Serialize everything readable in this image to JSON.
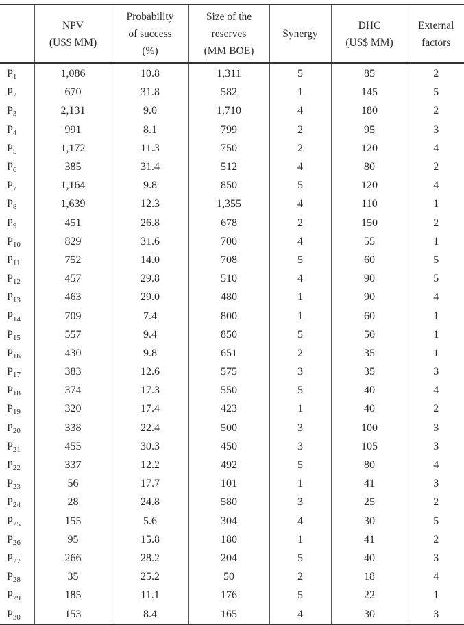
{
  "table": {
    "headers": [
      "",
      "NPV (US$ MM)",
      "Probability of success (%)",
      "Size of the reserves (MM BOE)",
      "Synergy",
      "DHC (US$ MM)",
      "External factors"
    ],
    "header_lines": [
      [
        ""
      ],
      [
        "NPV",
        "(US$ MM)"
      ],
      [
        "Probability",
        "of success",
        "(%)"
      ],
      [
        "Size of the",
        "reserves",
        "(MM BOE)"
      ],
      [
        "Synergy"
      ],
      [
        "DHC",
        "(US$ MM)"
      ],
      [
        "External",
        "factors"
      ]
    ],
    "rows": [
      {
        "id": "P",
        "sub": "1",
        "npv": "1,086",
        "pos": "10.8",
        "reserves": "1,311",
        "synergy": "5",
        "dhc": "85",
        "external": "2"
      },
      {
        "id": "P",
        "sub": "2",
        "npv": "670",
        "pos": "31.8",
        "reserves": "582",
        "synergy": "1",
        "dhc": "145",
        "external": "5"
      },
      {
        "id": "P",
        "sub": "3",
        "npv": "2,131",
        "pos": "9.0",
        "reserves": "1,710",
        "synergy": "4",
        "dhc": "180",
        "external": "2"
      },
      {
        "id": "P",
        "sub": "4",
        "npv": "991",
        "pos": "8.1",
        "reserves": "799",
        "synergy": "2",
        "dhc": "95",
        "external": "3"
      },
      {
        "id": "P",
        "sub": "5",
        "npv": "1,172",
        "pos": "11.3",
        "reserves": "750",
        "synergy": "2",
        "dhc": "120",
        "external": "4"
      },
      {
        "id": "P",
        "sub": "6",
        "npv": "385",
        "pos": "31.4",
        "reserves": "512",
        "synergy": "4",
        "dhc": "80",
        "external": "2"
      },
      {
        "id": "P",
        "sub": "7",
        "npv": "1,164",
        "pos": "9.8",
        "reserves": "850",
        "synergy": "5",
        "dhc": "120",
        "external": "4"
      },
      {
        "id": "P",
        "sub": "8",
        "npv": "1,639",
        "pos": "12.3",
        "reserves": "1,355",
        "synergy": "4",
        "dhc": "110",
        "external": "1"
      },
      {
        "id": "P",
        "sub": "9",
        "npv": "451",
        "pos": "26.8",
        "reserves": "678",
        "synergy": "2",
        "dhc": "150",
        "external": "2"
      },
      {
        "id": "P",
        "sub": "10",
        "npv": "829",
        "pos": "31.6",
        "reserves": "700",
        "synergy": "4",
        "dhc": "55",
        "external": "1"
      },
      {
        "id": "P",
        "sub": "11",
        "npv": "752",
        "pos": "14.0",
        "reserves": "708",
        "synergy": "5",
        "dhc": "60",
        "external": "5"
      },
      {
        "id": "P",
        "sub": "12",
        "npv": "457",
        "pos": "29.8",
        "reserves": "510",
        "synergy": "4",
        "dhc": "90",
        "external": "5"
      },
      {
        "id": "P",
        "sub": "13",
        "npv": "463",
        "pos": "29.0",
        "reserves": "480",
        "synergy": "1",
        "dhc": "90",
        "external": "4"
      },
      {
        "id": "P",
        "sub": "14",
        "npv": "709",
        "pos": "7.4",
        "reserves": "800",
        "synergy": "1",
        "dhc": "60",
        "external": "1"
      },
      {
        "id": "P",
        "sub": "15",
        "npv": "557",
        "pos": "9.4",
        "reserves": "850",
        "synergy": "5",
        "dhc": "50",
        "external": "1"
      },
      {
        "id": "P",
        "sub": "16",
        "npv": "430",
        "pos": "9.8",
        "reserves": "651",
        "synergy": "2",
        "dhc": "35",
        "external": "1"
      },
      {
        "id": "P",
        "sub": "17",
        "npv": "383",
        "pos": "12.6",
        "reserves": "575",
        "synergy": "3",
        "dhc": "35",
        "external": "3"
      },
      {
        "id": "P",
        "sub": "18",
        "npv": "374",
        "pos": "17.3",
        "reserves": "550",
        "synergy": "5",
        "dhc": "40",
        "external": "4"
      },
      {
        "id": "P",
        "sub": "19",
        "npv": "320",
        "pos": "17.4",
        "reserves": "423",
        "synergy": "1",
        "dhc": "40",
        "external": "2"
      },
      {
        "id": "P",
        "sub": "20",
        "npv": "338",
        "pos": "22.4",
        "reserves": "500",
        "synergy": "3",
        "dhc": "100",
        "external": "3"
      },
      {
        "id": "P",
        "sub": "21",
        "npv": "455",
        "pos": "30.3",
        "reserves": "450",
        "synergy": "3",
        "dhc": "105",
        "external": "3"
      },
      {
        "id": "P",
        "sub": "22",
        "npv": "337",
        "pos": "12.2",
        "reserves": "492",
        "synergy": "5",
        "dhc": "80",
        "external": "4"
      },
      {
        "id": "P",
        "sub": "23",
        "npv": "56",
        "pos": "17.7",
        "reserves": "101",
        "synergy": "1",
        "dhc": "41",
        "external": "3"
      },
      {
        "id": "P",
        "sub": "24",
        "npv": "28",
        "pos": "24.8",
        "reserves": "580",
        "synergy": "3",
        "dhc": "25",
        "external": "2"
      },
      {
        "id": "P",
        "sub": "25",
        "npv": "155",
        "pos": "5.6",
        "reserves": "304",
        "synergy": "4",
        "dhc": "30",
        "external": "5"
      },
      {
        "id": "P",
        "sub": "26",
        "npv": "95",
        "pos": "15.8",
        "reserves": "180",
        "synergy": "1",
        "dhc": "41",
        "external": "2"
      },
      {
        "id": "P",
        "sub": "27",
        "npv": "266",
        "pos": "28.2",
        "reserves": "204",
        "synergy": "5",
        "dhc": "40",
        "external": "3"
      },
      {
        "id": "P",
        "sub": "28",
        "npv": "35",
        "pos": "25.2",
        "reserves": "50",
        "synergy": "2",
        "dhc": "18",
        "external": "4"
      },
      {
        "id": "P",
        "sub": "29",
        "npv": "185",
        "pos": "11.1",
        "reserves": "176",
        "synergy": "5",
        "dhc": "22",
        "external": "1"
      },
      {
        "id": "P",
        "sub": "30",
        "npv": "153",
        "pos": "8.4",
        "reserves": "165",
        "synergy": "4",
        "dhc": "30",
        "external": "3"
      }
    ]
  }
}
